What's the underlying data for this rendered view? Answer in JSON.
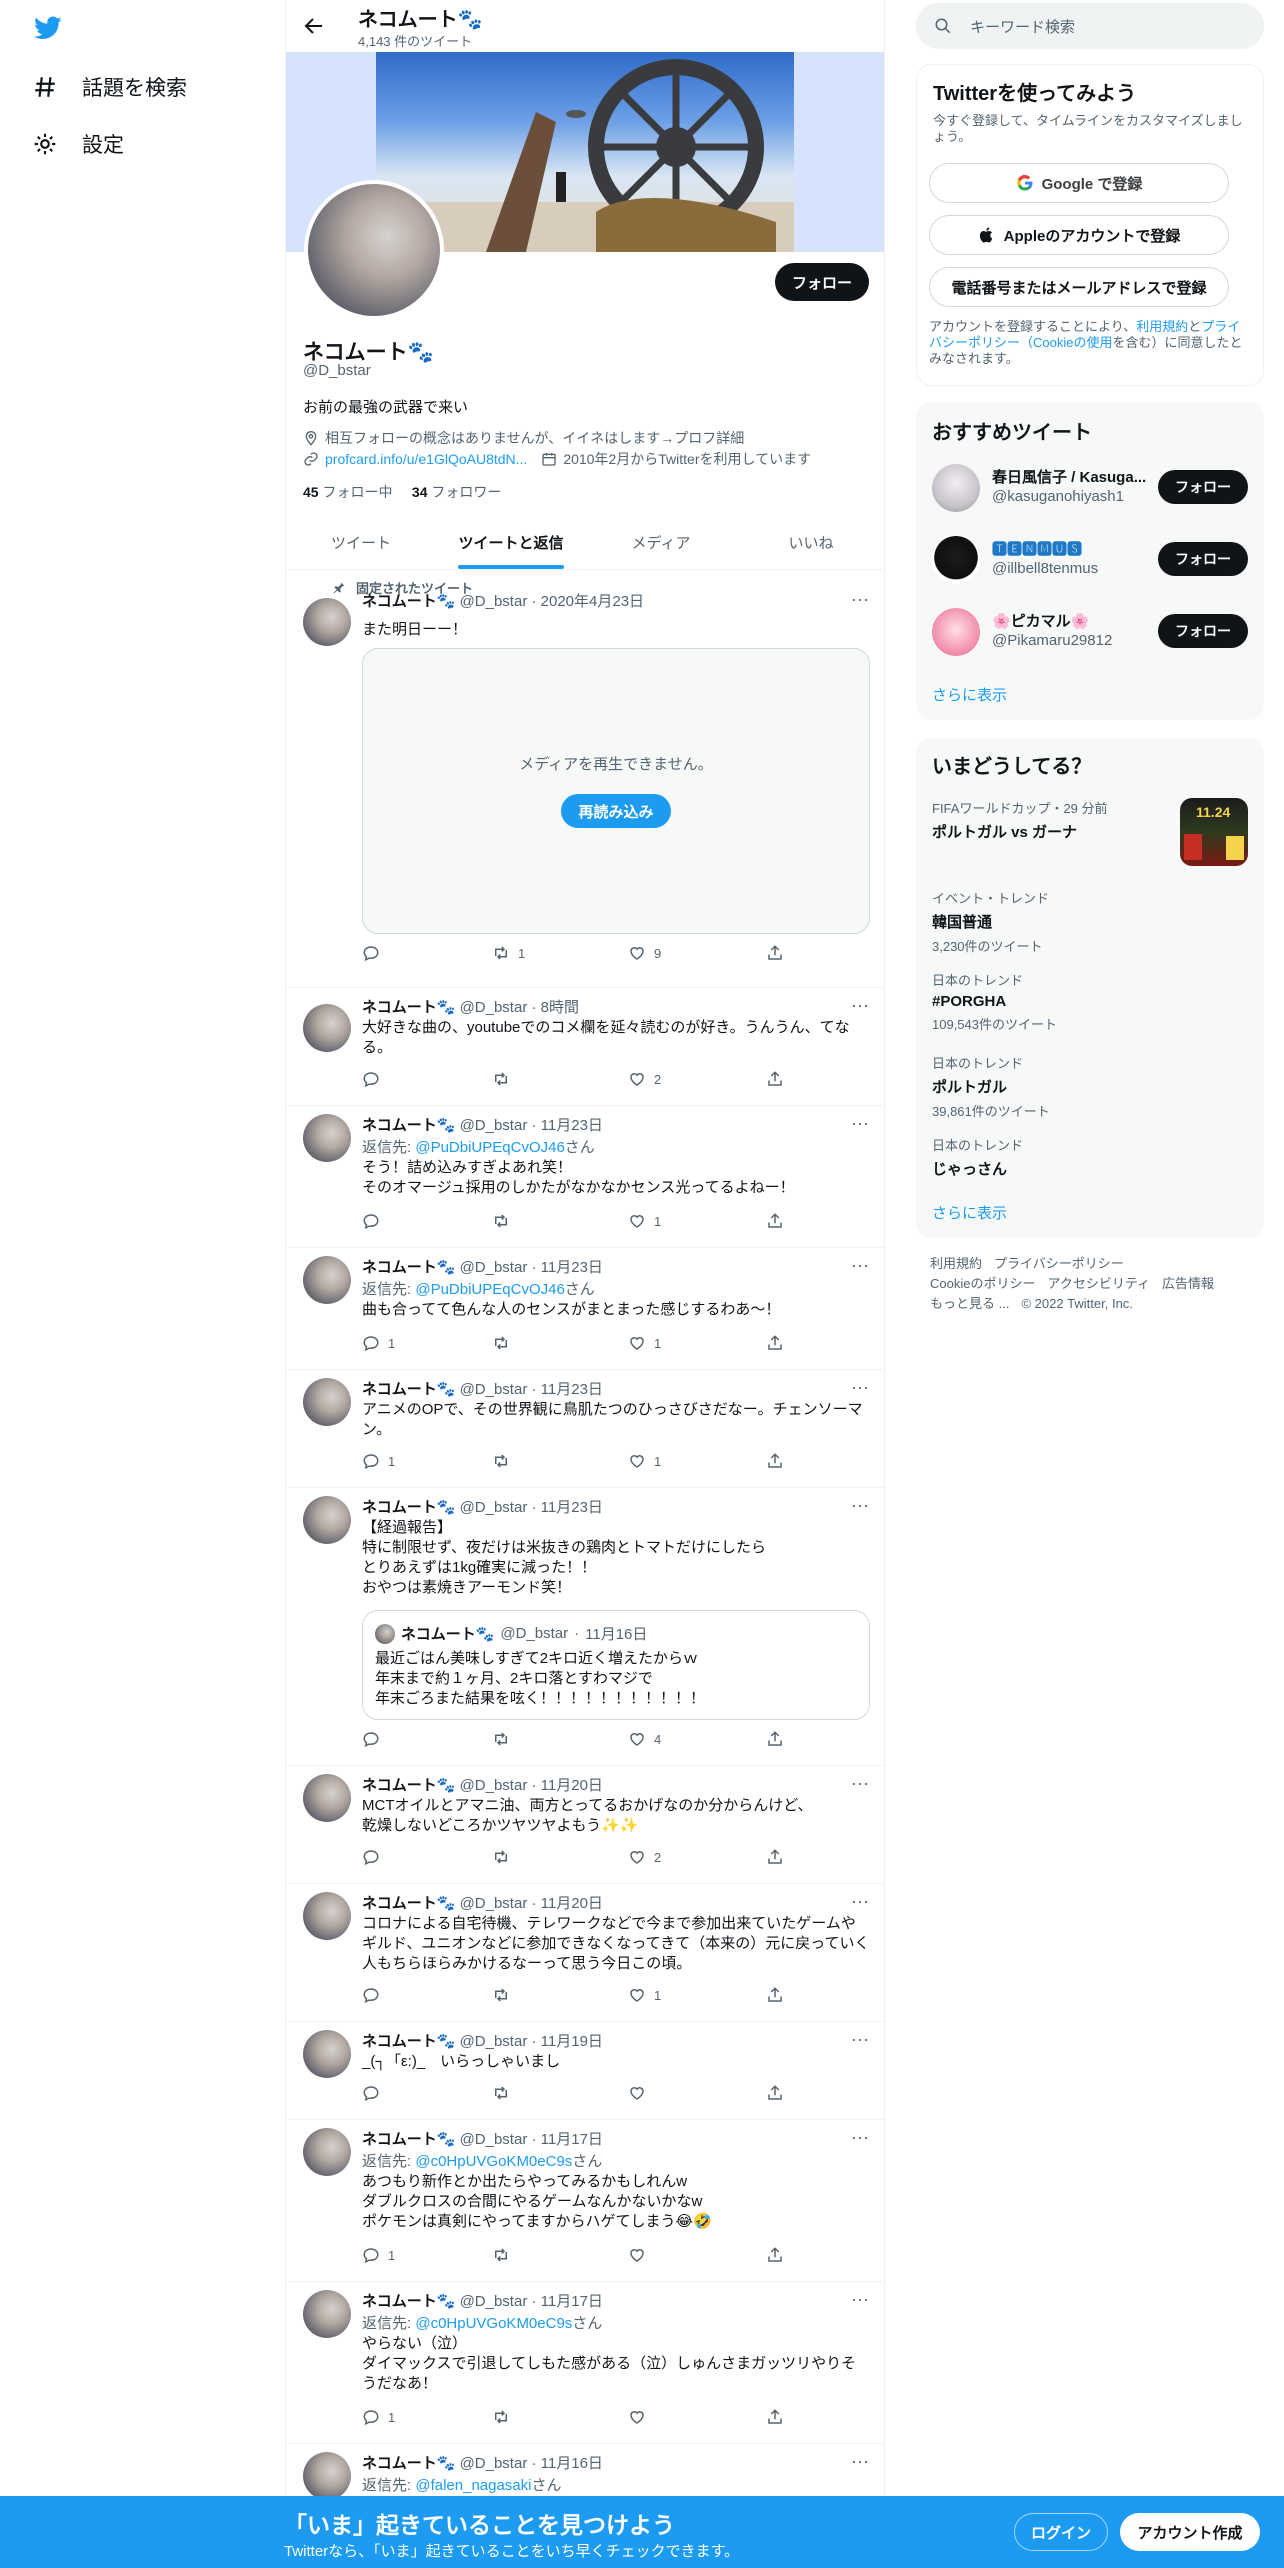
{
  "nav": {
    "explore_label": "話題を検索",
    "settings_label": "設定"
  },
  "profile": {
    "name": "ネコムート🐾",
    "tweet_count": "4,143 件のツイート",
    "handle": "@D_bstar",
    "bio": "お前の最強の武器で来い",
    "location": "相互フォローの概念はありませんが、イイネはします→プロフ詳細",
    "url": "profcard.info/u/e1GlQoAU8tdN...",
    "joined": "2010年2月からTwitterを利用しています",
    "following_num": "45",
    "following_label": "フォロー中",
    "followers_num": "34",
    "followers_label": "フォロワー",
    "follow_button": "フォロー"
  },
  "tabs": [
    "ツイート",
    "ツイートと返信",
    "メディア",
    "いいね"
  ],
  "pinned_label": "固定されたツイート",
  "media": {
    "message": "メディアを再生できません。",
    "reload": "再読み込み"
  },
  "tweets": [
    {
      "name": "ネコムート🐾",
      "handle": "@D_bstar",
      "time": "2020年4月23日",
      "reply_to_prefix": "",
      "reply_to": "",
      "reply_to_suffix": "",
      "text": "また明日ーー！",
      "stats": {
        "reply": "",
        "retweet": "1",
        "like": "9"
      }
    },
    {
      "name": "ネコムート🐾",
      "handle": "@D_bstar",
      "time": "8時間",
      "reply_to_prefix": "",
      "reply_to": "",
      "reply_to_suffix": "",
      "text": "大好きな曲の、youtubeでのコメ欄を延々読むのが好き。うんうん、てなる。",
      "stats": {
        "reply": "",
        "retweet": "",
        "like": "2"
      }
    },
    {
      "name": "ネコムート🐾",
      "handle": "@D_bstar",
      "time": "11月23日",
      "reply_to_prefix": "返信先: ",
      "reply_to": "@PuDbiUPEqCvOJ46",
      "reply_to_suffix": "さん",
      "text": "そう！詰め込みすぎよあれ笑！\nそのオマージュ採用のしかたがなかなかセンス光ってるよねー！",
      "stats": {
        "reply": "",
        "retweet": "",
        "like": "1"
      }
    },
    {
      "name": "ネコムート🐾",
      "handle": "@D_bstar",
      "time": "11月23日",
      "reply_to_prefix": "返信先: ",
      "reply_to": "@PuDbiUPEqCvOJ46",
      "reply_to_suffix": "さん",
      "text": "曲も合ってて色んな人のセンスがまとまった感じするわあ〜！",
      "stats": {
        "reply": "1",
        "retweet": "",
        "like": "1"
      }
    },
    {
      "name": "ネコムート🐾",
      "handle": "@D_bstar",
      "time": "11月23日",
      "reply_to_prefix": "",
      "reply_to": "",
      "reply_to_suffix": "",
      "text": "アニメのOPで、その世界観に鳥肌たつのひっさびさだなー。チェンソーマン。",
      "stats": {
        "reply": "1",
        "retweet": "",
        "like": "1"
      }
    },
    {
      "name": "ネコムート🐾",
      "handle": "@D_bstar",
      "time": "11月23日",
      "reply_to_prefix": "",
      "reply_to": "",
      "reply_to_suffix": "",
      "text": "【経過報告】\n特に制限せず、夜だけは米抜きの鶏肉とトマトだけにしたら\nとりあえずは1kg確実に減った！！\nおやつは素焼きアーモンド笑！",
      "stats": {
        "reply": "",
        "retweet": "",
        "like": "4"
      }
    },
    {
      "name": "ネコムート🐾",
      "handle": "@D_bstar",
      "time": "11月20日",
      "reply_to_prefix": "",
      "reply_to": "",
      "reply_to_suffix": "",
      "text": "MCTオイルとアマニ油、両方とってるおかげなのか分からんけど、\n乾燥しないどころかツヤツヤよもう✨✨",
      "stats": {
        "reply": "",
        "retweet": "",
        "like": "2"
      }
    },
    {
      "name": "ネコムート🐾",
      "handle": "@D_bstar",
      "time": "11月20日",
      "reply_to_prefix": "",
      "reply_to": "",
      "reply_to_suffix": "",
      "text": "コロナによる自宅待機、テレワークなどで今まで参加出来ていたゲームやギルド、ユニオンなどに参加できなくなってきて（本来の）元に戻っていく人もちらほらみかけるなーって思う今日この頃。",
      "stats": {
        "reply": "",
        "retweet": "",
        "like": "1"
      }
    },
    {
      "name": "ネコムート🐾",
      "handle": "@D_bstar",
      "time": "11月19日",
      "reply_to_prefix": "",
      "reply_to": "",
      "reply_to_suffix": "",
      "text": "_(┐「ε:)_　いらっしゃいまし",
      "stats": {
        "reply": "",
        "retweet": "",
        "like": ""
      }
    },
    {
      "name": "ネコムート🐾",
      "handle": "@D_bstar",
      "time": "11月17日",
      "reply_to_prefix": "返信先: ",
      "reply_to": "@c0HpUVGoKM0eC9s",
      "reply_to_suffix": "さん",
      "text": "あつもり新作とか出たらやってみるかもしれんw\nダブルクロスの合間にやるゲームなんかないかなw\nポケモンは真剣にやってますからハゲてしまう😂🤣",
      "stats": {
        "reply": "1",
        "retweet": "",
        "like": ""
      }
    },
    {
      "name": "ネコムート🐾",
      "handle": "@D_bstar",
      "time": "11月17日",
      "reply_to_prefix": "返信先: ",
      "reply_to": "@c0HpUVGoKM0eC9s",
      "reply_to_suffix": "さん",
      "text": "やらない（泣）\nダイマックスで引退してしもた感がある（泣）しゅんさまガッツリやりそうだなあ！",
      "stats": {
        "reply": "1",
        "retweet": "",
        "like": ""
      }
    },
    {
      "name": "ネコムート🐾",
      "handle": "@D_bstar",
      "time": "11月16日",
      "reply_to_prefix": "返信先: ",
      "reply_to": "@falen_nagasaki",
      "reply_to_suffix": "さん",
      "text": "",
      "stats": {
        "reply": "",
        "retweet": "",
        "like": ""
      }
    }
  ],
  "quote": {
    "name": "ネコムート🐾",
    "handle": "@D_bstar",
    "time": "11月16日",
    "text": "最近ごはん美味しすぎて2キロ近く増えたからｗ\n年末まで約１ヶ月、2キロ落とすわマジで\n年末ごろまた結果を呟く！！！！！！！！！！！"
  },
  "search": {
    "placeholder": "キーワード検索"
  },
  "signup": {
    "title": "Twitterを使ってみよう",
    "subtitle": "今すぐ登録して、タイムラインをカスタマイズしましょう。",
    "google": "Google で登録",
    "apple": "Appleのアカウントで登録",
    "phone": "電話番号またはメールアドレスで登録",
    "legal_pre": "アカウントを登録することにより、",
    "legal_terms": "利用規約",
    "legal_and": "と",
    "legal_privacy": "プライバシーポリシー（Cookieの使用",
    "legal_post": "を含む）に同意したとみなされます。"
  },
  "recommend": {
    "title": "おすすめツイート",
    "follow": "フォロー",
    "more": "さらに表示",
    "users": [
      {
        "name": "春日風信子 / Kasuga...",
        "handle": "@kasuganohiyash1"
      },
      {
        "name": "🆃🅴🅽🅼🆄🆂",
        "handle": "@illbell8tenmus"
      },
      {
        "name": "🌸ピカマル🌸",
        "handle": "@Pikamaru29812"
      }
    ]
  },
  "trends": {
    "title": "いまどうしてる？",
    "more": "さらに表示",
    "thumb_text": "11.24",
    "items": [
      {
        "category": "FIFAワールドカップ・29 分前",
        "name": "ポルトガル vs ガーナ",
        "count": ""
      },
      {
        "category": "イベント・トレンド",
        "name": "韓国普通",
        "count": "3,230件のツイート"
      },
      {
        "category": "日本のトレンド",
        "name": "#PORGHA",
        "count": "109,543件のツイート"
      },
      {
        "category": "日本のトレンド",
        "name": "ポルトガル",
        "count": "39,861件のツイート"
      },
      {
        "category": "日本のトレンド",
        "name": "じゃっさん",
        "count": ""
      }
    ]
  },
  "footer": {
    "line1": [
      "利用規約",
      "プライバシーポリシー"
    ],
    "line2": [
      "Cookieのポリシー",
      "アクセシビリティ",
      "広告情報"
    ],
    "line3": [
      "もっと見る ...",
      "© 2022 Twitter, Inc."
    ]
  },
  "bottom": {
    "title": "「いま」起きていることを見つけよう",
    "subtitle": "Twitterなら、「いま」起きていることをいち早くチェックできます。",
    "login": "ログイン",
    "signup": "アカウント作成"
  },
  "colors": {
    "accent": "#1d9bf0",
    "text": "#0f1419",
    "muted": "#536471"
  }
}
